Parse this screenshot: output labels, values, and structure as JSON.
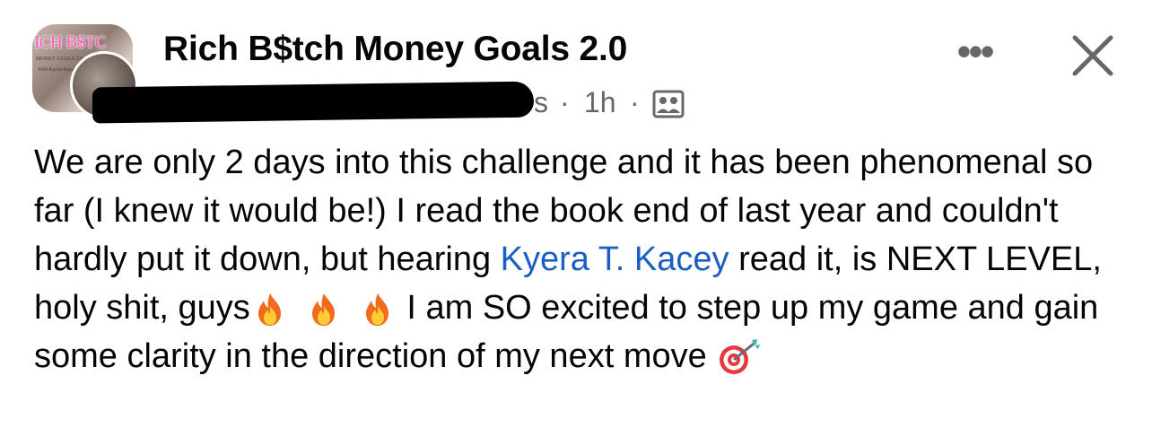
{
  "post": {
    "group_name": "Rich B$tch Money Goals 2.0",
    "group_avatar_text": "ICH B$TC",
    "group_avatar_subtext": "MONEY GOALS 2.0",
    "group_avatar_script": "With Kyera Kacey",
    "author_visible_fragment": "s",
    "separator": "·",
    "timestamp": "1h",
    "audience_icon": "members-icon",
    "more_label": "•••",
    "close_icon": "close-icon",
    "body": {
      "segment_1": "We are only 2 days into this challenge and it has been phenomenal so far (I knew it would be!) I read the book end of last year and couldn't hardly put it down, but hearing ",
      "mention": "Kyera T. Kacey",
      "segment_2": " read it, is NEXT LEVEL, holy shit, guys",
      "emojis_after_segment_2": [
        "fire-icon",
        "fire-icon",
        "fire-icon"
      ],
      "segment_3": " I am SO excited to step up my game and gain some clarity in the direction of my next move ",
      "emoji_end": "target-icon"
    },
    "colors": {
      "text": "#050505",
      "secondary_text": "#65676b",
      "mention": "#1b5fc4"
    }
  }
}
